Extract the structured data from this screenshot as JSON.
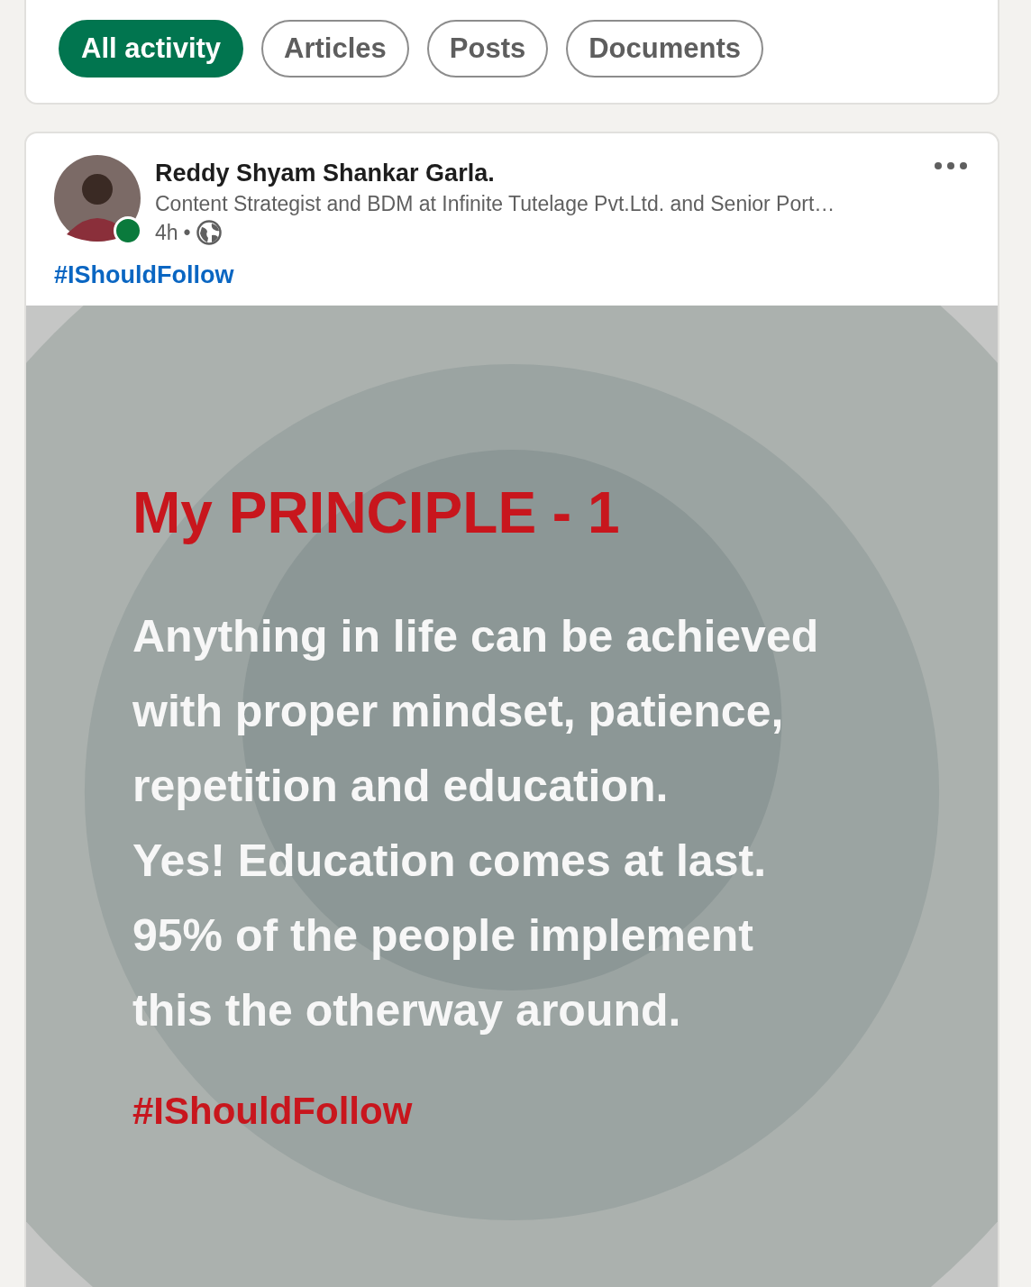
{
  "filters": [
    {
      "label": "All activity",
      "selected": true
    },
    {
      "label": "Articles",
      "selected": false
    },
    {
      "label": "Posts",
      "selected": false
    },
    {
      "label": "Documents",
      "selected": false
    }
  ],
  "post": {
    "author": "Reddy Shyam Shankar Garla.",
    "online": true,
    "headline": "Content Strategist and BDM at Infinite Tutelage Pvt.Ltd. and Senior Port…",
    "time": "4h",
    "separator": "•",
    "hashtag": "#IShouldFollow",
    "image": {
      "heading": "My PRINCIPLE - 1",
      "lines": [
        "Anything in life can be achieved",
        "with proper mindset, patience,",
        "repetition and education.",
        "Yes! Education comes at last.",
        "95% of the people implement",
        "this the otherway around."
      ],
      "hashtag": "#IShouldFollow"
    }
  }
}
